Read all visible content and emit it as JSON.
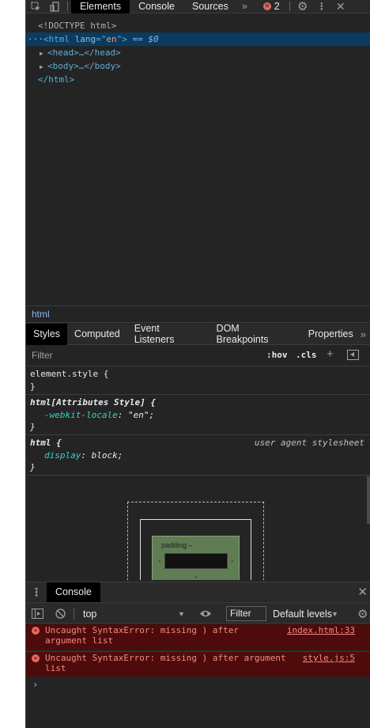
{
  "toolbar": {
    "tabs": [
      "Elements",
      "Console",
      "Sources"
    ],
    "overflow": "»",
    "error_count": "2"
  },
  "dom": {
    "doctype": "<!DOCTYPE html>",
    "html_open_tag": "<html",
    "html_attr_name": " lang",
    "html_attr_eq": "=\"",
    "html_attr_value": "en",
    "html_attr_close": "\">",
    "selected_marker": " == $0",
    "head": "<head>…</head>",
    "body": "<body>…</body>",
    "html_close": "</html>"
  },
  "breadcrumb": {
    "item": "html"
  },
  "sidebar_tabs": [
    "Styles",
    "Computed",
    "Event Listeners",
    "DOM Breakpoints",
    "Properties"
  ],
  "styles": {
    "filter_placeholder": "Filter",
    "hov": ":hov",
    "cls": ".cls",
    "rules": [
      {
        "selector": "element.style {",
        "close": "}"
      },
      {
        "selector": "html[Attributes Style] {",
        "property": "-webkit-locale",
        "value": "\"en\";",
        "close": "}"
      },
      {
        "selector": "html {",
        "origin": "user agent stylesheet",
        "property": "display",
        "value": "block;",
        "close": "}"
      }
    ]
  },
  "box_model": {
    "padding_label": "padding –",
    "dash": "-"
  },
  "console_drawer": {
    "tab_label": "Console",
    "context": "top",
    "filter": "Filter",
    "levels": "Default levels"
  },
  "console_messages": [
    {
      "text": "Uncaught SyntaxError: missing ) after\nargument list",
      "source": "index.html:33"
    },
    {
      "text": "Uncaught SyntaxError: missing ) after argument\nlist",
      "source": "style.js:5"
    }
  ],
  "prompt": "›"
}
